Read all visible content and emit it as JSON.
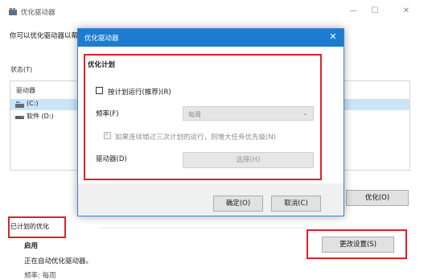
{
  "window": {
    "title": "优化驱动器",
    "minimize_glyph": "—",
    "maximize_glyph": "☐",
    "close_glyph": "✕",
    "description": "你可以优化驱动器以帮"
  },
  "status": {
    "label": "状态(T)",
    "column_header": "驱动器",
    "drives": [
      {
        "name": "(C:)",
        "icon": "windows-drive-icon",
        "selected": true
      },
      {
        "name": "软件 (D:)",
        "icon": "hard-drive-icon",
        "selected": false
      }
    ]
  },
  "optimize_button": "优化(O)",
  "scheduled": {
    "title": "已计划的优化",
    "enabled_label": "启用",
    "auto_text": "正在自动优化驱动器。",
    "frequency_text": "频率: 每周"
  },
  "change_settings_button": "更改设置(S)",
  "dialog": {
    "title": "优化驱动器",
    "close_glyph": "✕",
    "plan_title": "优化计划",
    "run_on_schedule": {
      "label": "按计划运行(推荐)(R)",
      "checked": false
    },
    "frequency": {
      "label": "频率(F)",
      "value": "每周",
      "arrow": "⌄"
    },
    "increase_priority": {
      "label": "如果连续错过三次计划的运行，则增大任务优先级(N)",
      "checked": true
    },
    "drives": {
      "label": "驱动器(D)",
      "button": "选择(H)"
    },
    "ok": "确定(O)",
    "cancel": "取消(C)"
  },
  "colors": {
    "accent": "#1d7ccf",
    "highlight": "#e0202a",
    "selection": "#cce4f7"
  }
}
